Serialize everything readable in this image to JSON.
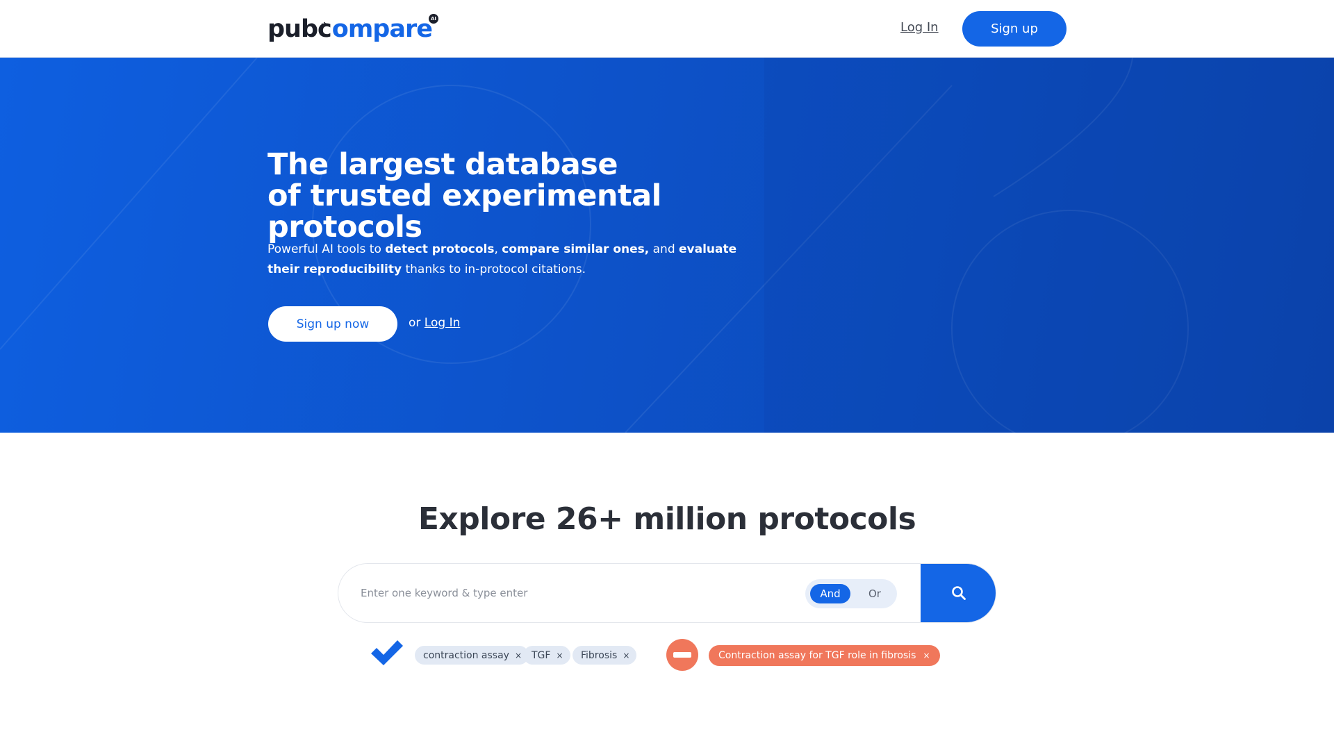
{
  "brand": {
    "logo_pub": "pub",
    "logo_c": "c",
    "logo_compare": "ompare",
    "logo_badge": "AI"
  },
  "header": {
    "login_label": "Log In",
    "signup_label": "Sign up"
  },
  "hero": {
    "title_line1": "The largest database",
    "title_line2": "of trusted experimental protocols",
    "sub_p1": "Powerful AI tools to ",
    "sub_b1": "detect protocols",
    "sub_p2": ", ",
    "sub_b2": "compare similar ones,",
    "sub_p3": " and ",
    "sub_b3": "evaluate their reproducibility",
    "sub_p4": " thanks to in-protocol citations.",
    "cta_label": "Sign up now",
    "or_text": "or ",
    "or_login": "Log In"
  },
  "explore": {
    "title": "Explore 26+ million protocols",
    "search_placeholder": "Enter one keyword & type enter",
    "toggle_and": "And",
    "toggle_or": "Or"
  },
  "include_tags": [
    "contraction assay",
    "TGF",
    "Fibrosis"
  ],
  "exclude_tags": [
    "Contraction assay for TGF role in fibrosis"
  ],
  "remove_symbol": "×",
  "icons": {
    "search": "search-icon",
    "include": "check-icon",
    "exclude": "minus-icon"
  },
  "colors": {
    "brand_blue": "#1466e6",
    "dark_text": "#2b2f38",
    "chip_bg": "#e2e9f4",
    "exclude_red": "#f0775b"
  }
}
